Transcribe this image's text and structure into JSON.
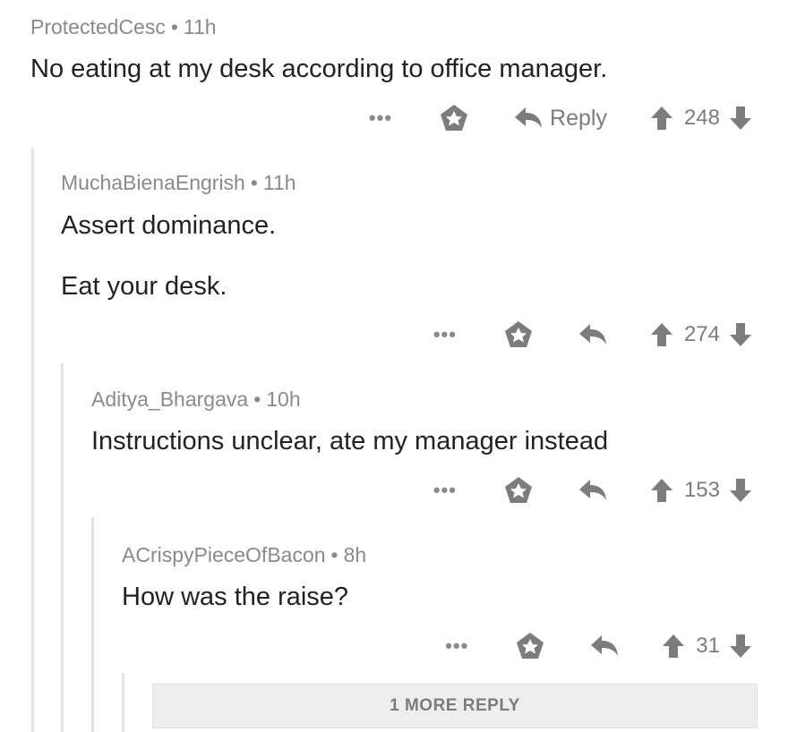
{
  "comments": [
    {
      "author": "ProtectedCesc",
      "separator": "•",
      "time": "11h",
      "lines": [
        "No eating at my desk according to office manager."
      ],
      "reply_label": "Reply",
      "score": "248",
      "more_glyph": "•••"
    },
    {
      "author": "MuchaBienaEngrish",
      "separator": "•",
      "time": "11h",
      "lines": [
        "Assert dominance.",
        "Eat your desk."
      ],
      "score": "274",
      "more_glyph": "•••"
    },
    {
      "author": "Aditya_Bhargava",
      "separator": "•",
      "time": "10h",
      "lines": [
        "Instructions unclear, ate my manager instead"
      ],
      "score": "153",
      "more_glyph": "•••"
    },
    {
      "author": "ACrispyPieceOfBacon",
      "separator": "•",
      "time": "8h",
      "lines": [
        "How was the raise?"
      ],
      "score": "31",
      "more_glyph": "•••"
    }
  ],
  "more_replies": {
    "label": "1 MORE REPLY"
  },
  "icons": {
    "more": "more-options-icon",
    "save": "save-star-icon",
    "reply": "reply-arrow-icon",
    "upvote": "upvote-arrow-icon",
    "downvote": "downvote-arrow-icon"
  },
  "colors": {
    "text": "#222222",
    "meta": "#8a8a8a",
    "icon": "#7c7c7c",
    "thread_line": "#e3e3e3",
    "more_replies_bg": "#eeeeee"
  }
}
